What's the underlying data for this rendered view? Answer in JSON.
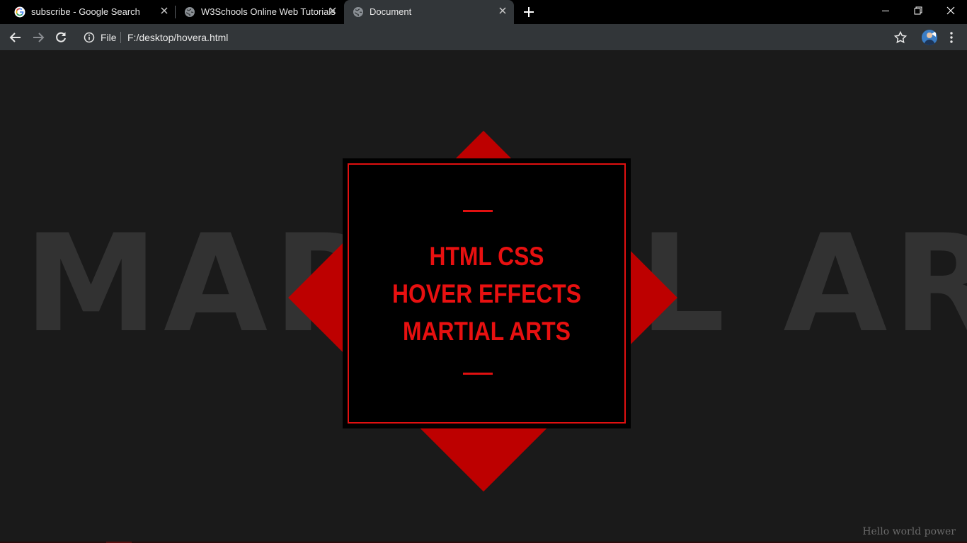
{
  "tabs": [
    {
      "title": "subscribe - Google Search",
      "icon": "google-icon",
      "active": false
    },
    {
      "title": "W3Schools Online Web Tutorials",
      "icon": "globe-icon",
      "active": false
    },
    {
      "title": "Document",
      "icon": "globe-icon",
      "active": true
    }
  ],
  "address_bar": {
    "chip": "File",
    "url": "F:/desktop/hovera.html"
  },
  "page": {
    "background_text": "MARTIAL ARTS",
    "card": {
      "line1": "HTML CSS",
      "line2": "HOVER EFFECTS",
      "line3": "MARTIAL ARTS"
    },
    "footer_note": "Hello world power"
  },
  "colors": {
    "accent_red": "#e01010",
    "diamond_red": "#bd0000",
    "page_bg": "#1a1a1a"
  }
}
